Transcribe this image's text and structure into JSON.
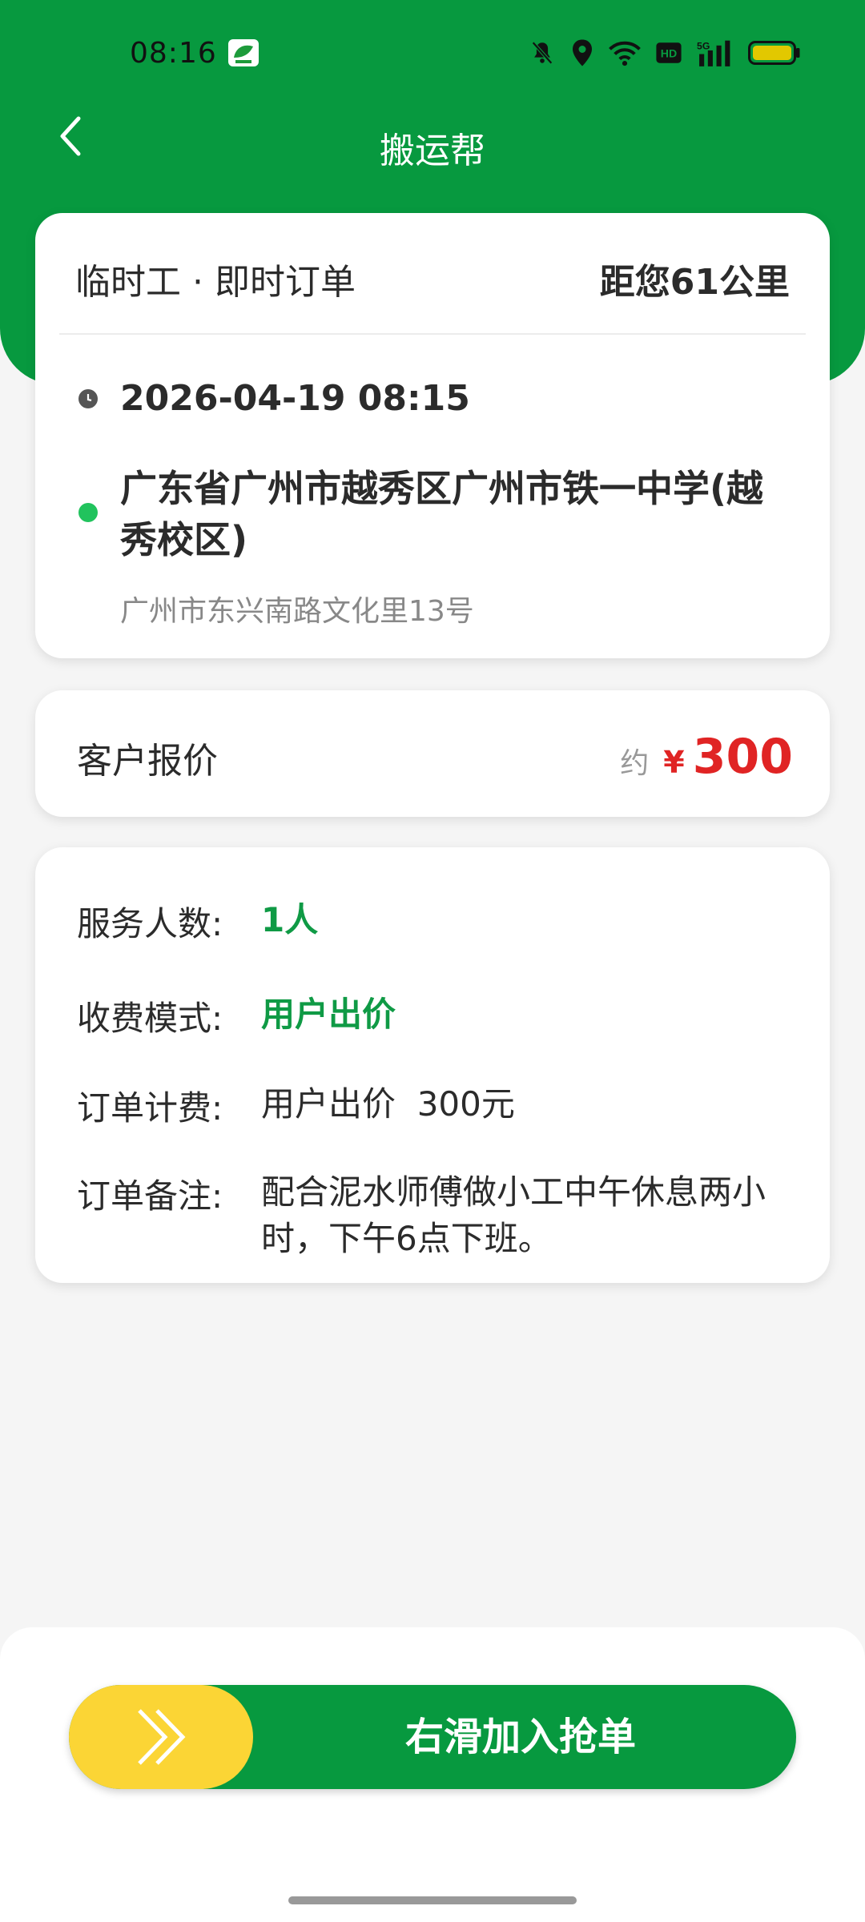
{
  "status_bar": {
    "time": "08:16",
    "icons": [
      "app-notification-icon",
      "mute-icon",
      "location-icon",
      "wifi-icon",
      "hd-icon",
      "signal-5g-icon",
      "battery-icon"
    ],
    "battery_color": "#e2c800"
  },
  "nav": {
    "title": "搬运帮",
    "back_icon": "chevron-left-icon"
  },
  "order": {
    "type": "临时工 · 即时订单",
    "distance": "距您61公里",
    "time": "2026-04-19 08:15",
    "address_name": "广东省广州市越秀区广州市铁一中学(越秀校区)",
    "address_detail": "广州市东兴南路文化里13号"
  },
  "price": {
    "label": "客户报价",
    "prefix": "约",
    "currency": "¥",
    "amount": "300"
  },
  "info": {
    "rows": [
      {
        "key": "服务人数:",
        "value": "1人"
      },
      {
        "key": "收费模式:",
        "value": "用户出价"
      },
      {
        "key": "订单计费:",
        "value": "用户出价  300元"
      },
      {
        "key": "订单备注:",
        "value": "配合泥水师傅做小工中午休息两小时，下午6点下班。"
      }
    ]
  },
  "action": {
    "slider_label": "右滑加入抢单",
    "knob_icon": "double-chevron-right-icon"
  },
  "colors": {
    "brand_green": "#07993f",
    "accent_yellow": "#fbd535",
    "price_red": "#e02424",
    "highlight_green": "#0f9a45",
    "dot_green": "#21c35d"
  }
}
